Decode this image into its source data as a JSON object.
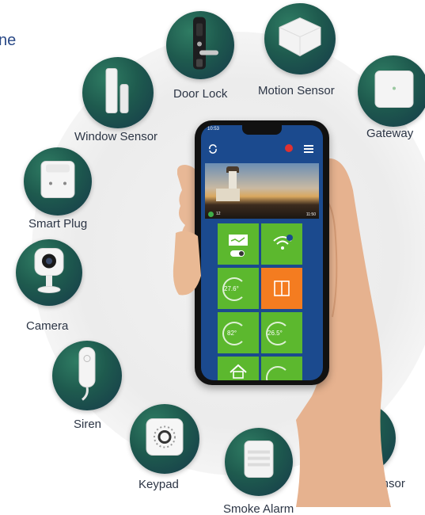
{
  "heading_fragment": "ne",
  "devices": [
    {
      "id": "door-lock",
      "label": "Door Lock",
      "icon": "door-lock-icon"
    },
    {
      "id": "motion-sensor",
      "label": "Motion Sensor",
      "icon": "motion-sensor-icon"
    },
    {
      "id": "gateway",
      "label": "Gateway",
      "icon": "gateway-icon"
    },
    {
      "id": "window-sensor",
      "label": "Window Sensor",
      "icon": "window-sensor-icon"
    },
    {
      "id": "smart-plug",
      "label": "Smart Plug",
      "icon": "smart-plug-icon"
    },
    {
      "id": "camera",
      "label": "Camera",
      "icon": "camera-icon"
    },
    {
      "id": "siren",
      "label": "Siren",
      "icon": "siren-icon"
    },
    {
      "id": "keypad",
      "label": "Keypad",
      "icon": "keypad-icon"
    },
    {
      "id": "smoke-alarm",
      "label": "Smoke Alarm",
      "icon": "smoke-alarm-icon"
    },
    {
      "id": "water-leak-sensor",
      "label": "Water Leak Sensor",
      "icon": "water-leak-sensor-icon"
    }
  ],
  "phone": {
    "status_time": "10:53",
    "camera_count": "12",
    "camera_time": "11:50",
    "tiles": [
      {
        "value": ""
      },
      {
        "value": ""
      },
      {
        "value": "27.6°"
      },
      {
        "value": ""
      },
      {
        "value": "82°"
      },
      {
        "value": "26.5°"
      },
      {
        "value": ""
      },
      {
        "value": ""
      }
    ]
  },
  "colors": {
    "device_circle": "#1e5a4e",
    "label_text": "#2c3545",
    "app_background": "#1b4a8e",
    "tile_green": "#5cb82e",
    "tile_orange": "#f47c20",
    "heading_text": "#2b4a87"
  }
}
